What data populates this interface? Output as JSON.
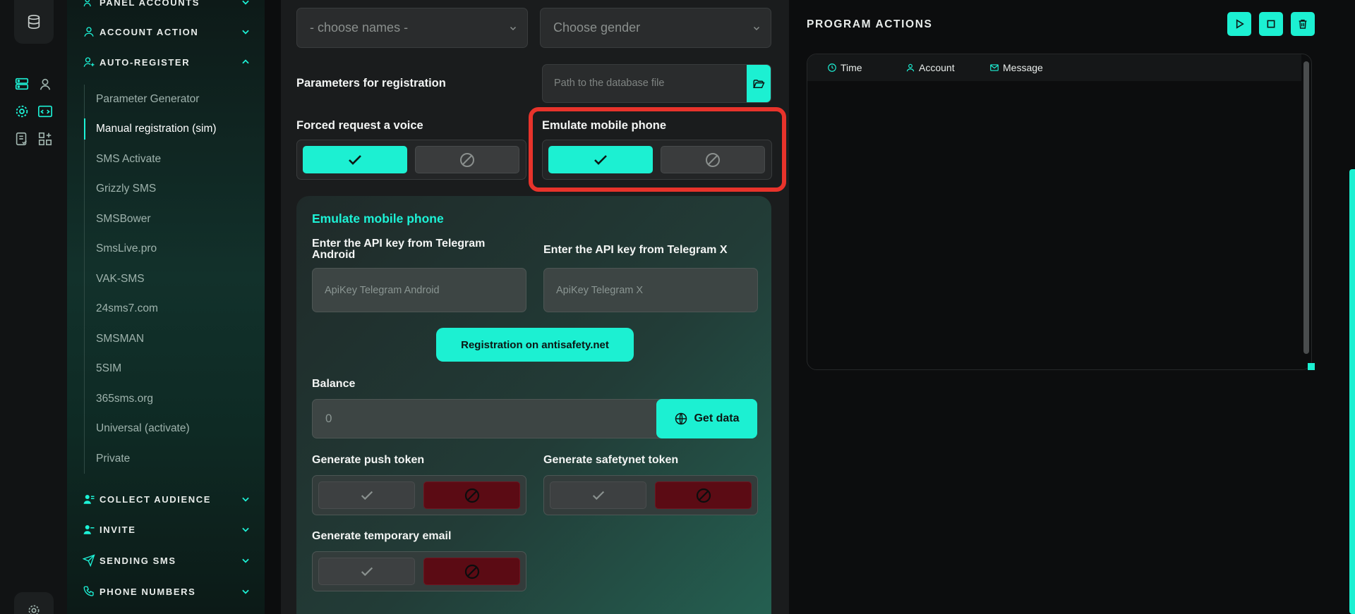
{
  "sidebar": {
    "sections": {
      "panel_accounts": "PANEL ACCOUNTS",
      "account_action": "ACCOUNT ACTION",
      "auto_register": "AUTO-REGISTER",
      "collect_audience": "COLLECT AUDIENCE",
      "invite": "INVITE",
      "sending_sms": "SENDING SMS",
      "phone_numbers": "PHONE NUMBERS"
    },
    "auto_register_items": [
      "Parameter Generator",
      "Manual registration (sim)",
      "SMS Activate",
      "Grizzly SMS",
      "SMSBower",
      "SmsLive.pro",
      "VAK-SMS",
      "24sms7.com",
      "SMSMAN",
      "5SIM",
      "365sms.org",
      "Universal (activate)",
      "Private"
    ],
    "active_item": "Manual registration (sim)"
  },
  "main": {
    "names_select": "- choose names -",
    "gender_select": "Choose gender",
    "params_label": "Parameters for registration",
    "db_path_placeholder": "Path to the database file",
    "forced_voice_label": "Forced request a voice",
    "forced_voice_on": true,
    "emulate_label": "Emulate mobile phone",
    "emulate_on": true,
    "card": {
      "title": "Emulate mobile phone",
      "api_android_label": "Enter the API key from Telegram Android",
      "api_android_placeholder": "ApiKey Telegram Android",
      "api_x_label": "Enter the API key from Telegram X",
      "api_x_placeholder": "ApiKey Telegram X",
      "register_button": "Registration on antisafety.net",
      "balance_label": "Balance",
      "balance_value": "0",
      "get_data_button": "Get data",
      "push_token_label": "Generate push token",
      "push_token_on": false,
      "safetynet_label": "Generate safetynet token",
      "safetynet_on": false,
      "temp_email_label": "Generate temporary email",
      "temp_email_on": false
    }
  },
  "right": {
    "title": "PROGRAM ACTIONS",
    "columns": [
      "Time",
      "Account",
      "Message"
    ]
  },
  "colors": {
    "accent": "#1cf0d2",
    "highlight": "#e8332b",
    "off_red": "#5b0b14"
  }
}
